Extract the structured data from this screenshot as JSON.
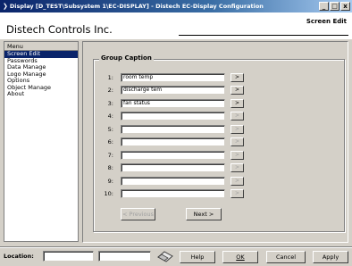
{
  "window": {
    "title": "Display [D_TEST\\Subsystem 1\\EC-DISPLAY] - Distech EC-Display Configuration",
    "minimize": "_",
    "maximize": "□",
    "close": "x"
  },
  "header": {
    "company": "Distech Controls Inc.",
    "screen": "Screen Edit"
  },
  "menu": {
    "title": "Menu",
    "items": [
      {
        "label": "Screen Edit",
        "selected": true
      },
      {
        "label": "Passwords"
      },
      {
        "label": "Data Manage"
      },
      {
        "label": "Logo Manage"
      },
      {
        "label": "Options"
      },
      {
        "label": "Object Manage"
      },
      {
        "label": "About"
      }
    ]
  },
  "group": {
    "title": "Group Caption",
    "rows": [
      {
        "num": "1:",
        "value": "room temp",
        "button": ">",
        "enabled": true
      },
      {
        "num": "2:",
        "value": "discharge tem",
        "button": ">",
        "enabled": true
      },
      {
        "num": "3:",
        "value": "fan status",
        "button": ">",
        "enabled": true
      },
      {
        "num": "4:",
        "value": "",
        "button": ">",
        "enabled": false
      },
      {
        "num": "5:",
        "value": "",
        "button": ">",
        "enabled": false
      },
      {
        "num": "6:",
        "value": "",
        "button": ">",
        "enabled": false
      },
      {
        "num": "7:",
        "value": "",
        "button": ">",
        "enabled": false
      },
      {
        "num": "8:",
        "value": "",
        "button": ">",
        "enabled": false
      },
      {
        "num": "9:",
        "value": "",
        "button": ">",
        "enabled": false
      },
      {
        "num": "10:",
        "value": "",
        "button": ">",
        "enabled": false
      }
    ],
    "previous": "< Previous",
    "next": "Next >"
  },
  "footer": {
    "location_label": "Location:",
    "location_value": "",
    "location_value2": "",
    "eraser_icon": "eraser-icon",
    "help": "Help",
    "ok": "OK",
    "cancel": "Cancel",
    "apply": "Apply"
  }
}
